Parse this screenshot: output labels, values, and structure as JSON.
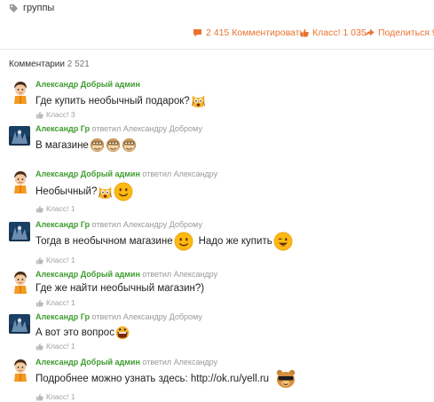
{
  "header": {
    "groups_label": "группы"
  },
  "actions": {
    "comments_label": "2 415 Комментировать",
    "like_label": "Класс! 1 035",
    "share_label": "Поделиться 9"
  },
  "comments_header": {
    "title": "Комментарии",
    "count": "2 521"
  },
  "comments": [
    {
      "author": "Александр Добрый админ",
      "replied": "",
      "text_a": "Где купить необычный подарок?",
      "text_b": "",
      "emojis": [
        "cat-shocked"
      ],
      "klass": "Класс! 3"
    },
    {
      "author": "Александр Гр",
      "replied": "ответил Александру Доброму",
      "text_a": "В магазине",
      "text_b": "",
      "emojis": [
        "monkey-eyes",
        "monkey-eyes",
        "monkey-eyes"
      ],
      "klass": ""
    },
    {
      "author": "Александр Добрый админ",
      "replied": "ответил Александру",
      "text_a": "Необычный?",
      "text_b": "",
      "emojis": [
        "cat-shocked",
        "smile"
      ],
      "klass": "Класс! 1"
    },
    {
      "author": "Александр Гр",
      "replied": "ответил Александру Доброму",
      "text_a": "Тогда в необычном магазине",
      "text_b": "Надо же купить",
      "emojis": [
        "smile",
        "wink"
      ],
      "klass": "Класс! 1"
    },
    {
      "author": "Александр Добрый админ",
      "replied": "ответил Александру",
      "text_a": "Где же найти необычный магазин?)",
      "text_b": "",
      "emojis": [],
      "klass": "Класс! 1"
    },
    {
      "author": "Александр Гр",
      "replied": "ответил Александру Доброму",
      "text_a": "А вот это вопрос",
      "text_b": "",
      "emojis": [
        "big-grin"
      ],
      "klass": "Класс! 1"
    },
    {
      "author": "Александр Добрый админ",
      "replied": "ответил Александру",
      "text_a": "Подробнее можно узнать здесь: http://ok.ru/yell.ru",
      "text_b": "",
      "emojis": [
        "cool-bear"
      ],
      "klass": "Класс! 1"
    }
  ],
  "colors": {
    "accent": "#eb722e",
    "author": "#3d9c2e",
    "muted": "#999999"
  }
}
